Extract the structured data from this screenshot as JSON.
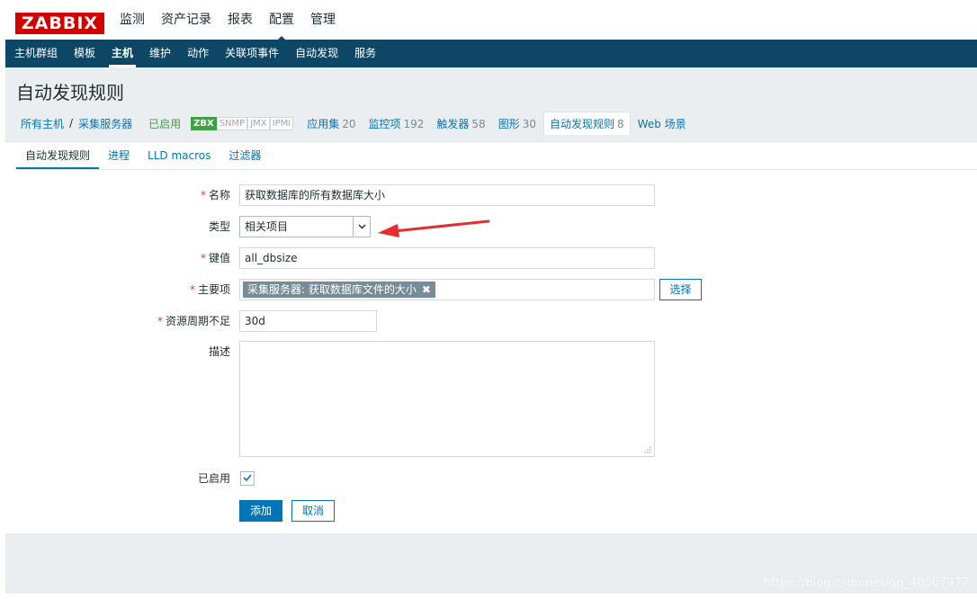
{
  "logo": "ZABBIX",
  "top_menu": [
    {
      "label": "监测",
      "active": false
    },
    {
      "label": "资产记录",
      "active": false
    },
    {
      "label": "报表",
      "active": false
    },
    {
      "label": "配置",
      "active": true
    },
    {
      "label": "管理",
      "active": false
    }
  ],
  "sub_menu": [
    {
      "label": "主机群组",
      "active": false
    },
    {
      "label": "模板",
      "active": false
    },
    {
      "label": "主机",
      "active": true
    },
    {
      "label": "维护",
      "active": false
    },
    {
      "label": "动作",
      "active": false
    },
    {
      "label": "关联项事件",
      "active": false
    },
    {
      "label": "自动发现",
      "active": false
    },
    {
      "label": "服务",
      "active": false
    }
  ],
  "page_title": "自动发现规则",
  "breadcrumb": {
    "all_hosts": "所有主机",
    "separator": "/",
    "host": "采集服务器",
    "status": "已启用",
    "badges": [
      "ZBX",
      "SNMP",
      "JMX",
      "IPMI"
    ]
  },
  "host_tabs": [
    {
      "label": "应用集",
      "count": "20"
    },
    {
      "label": "监控项",
      "count": "192"
    },
    {
      "label": "触发器",
      "count": "58"
    },
    {
      "label": "图形",
      "count": "30"
    },
    {
      "label": "自动发现规则",
      "count": "8"
    },
    {
      "label": "Web 场景",
      "count": ""
    }
  ],
  "form_tabs": [
    {
      "label": "自动发现规则",
      "active": true
    },
    {
      "label": "进程",
      "active": false
    },
    {
      "label": "LLD macros",
      "active": false
    },
    {
      "label": "过滤器",
      "active": false
    }
  ],
  "form": {
    "required_mark": "*",
    "name": {
      "label": "名称",
      "value": "获取数据库的所有数据库大小"
    },
    "type": {
      "label": "类型",
      "value": "相关项目"
    },
    "key": {
      "label": "键值",
      "value": "all_dbsize"
    },
    "master_item": {
      "label": "主要项",
      "value": "采集服务器: 获取数据库文件的大小",
      "remove_icon": "✖",
      "select_button": "选择"
    },
    "lifetime": {
      "label": "资源周期不足",
      "value": "30d"
    },
    "description": {
      "label": "描述",
      "value": ""
    },
    "enabled": {
      "label": "已启用",
      "checked": true,
      "check_glyph": "✓"
    },
    "add_button": "添加",
    "cancel_button": "取消"
  },
  "annotation_color": "#e52d2d",
  "watermark": "https://blog.csdn.net/qq_40907977"
}
